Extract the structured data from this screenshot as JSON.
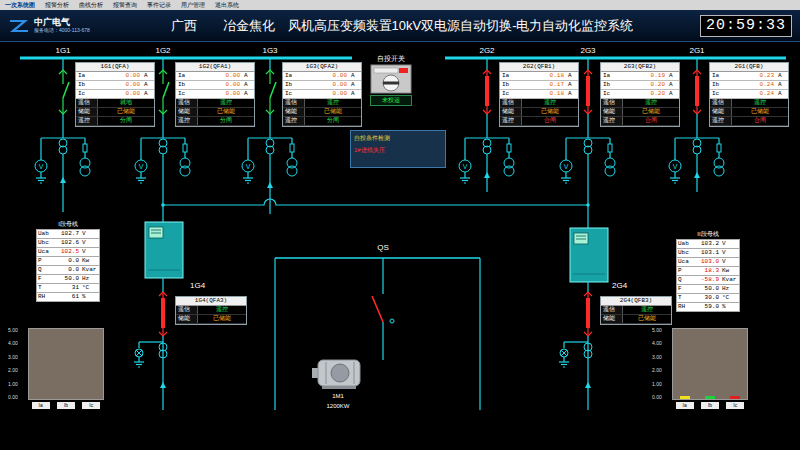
{
  "menu": [
    {
      "label": "一次系统图",
      "selected": true
    },
    {
      "label": "报警分析",
      "selected": false
    },
    {
      "label": "曲线分析",
      "selected": false
    },
    {
      "label": "报警查询",
      "selected": false
    },
    {
      "label": "事件记录",
      "selected": false
    },
    {
      "label": "用户管理",
      "selected": false
    },
    {
      "label": "退出系统",
      "selected": false
    }
  ],
  "header": {
    "logo": "中广电气",
    "phone": "服务电话：4000-113-678",
    "title": "广西　　冶金焦化　风机高压变频装置10kV双电源自动切换-电力自动化监控系统",
    "clock": "20:59:33"
  },
  "meter_glyph": "V",
  "feeders": [
    {
      "label": "1G1",
      "box_title": "1G1(QFA)",
      "closed": false,
      "currents": [
        {
          "name": "Ia",
          "value": "0.00",
          "unit": "A"
        },
        {
          "name": "Ib",
          "value": "0.00",
          "unit": "A"
        },
        {
          "name": "Ic",
          "value": "0.00",
          "unit": "A"
        }
      ],
      "status": [
        {
          "label": "遥信",
          "value": "就地"
        },
        {
          "label": "储能",
          "value": "已储能"
        },
        {
          "label": "遥控",
          "value": "分闸"
        }
      ]
    },
    {
      "label": "1G2",
      "box_title": "1G2(QFA1)",
      "closed": false,
      "currents": [
        {
          "name": "Ia",
          "value": "0.00",
          "unit": "A"
        },
        {
          "name": "Ib",
          "value": "0.00",
          "unit": "A"
        },
        {
          "name": "Ic",
          "value": "0.00",
          "unit": "A"
        }
      ],
      "status": [
        {
          "label": "遥信",
          "value": "遥控"
        },
        {
          "label": "储能",
          "value": "已储能"
        },
        {
          "label": "遥控",
          "value": "分闸"
        }
      ]
    },
    {
      "label": "1G3",
      "box_title": "1G3(QFA2)",
      "closed": false,
      "currents": [
        {
          "name": "Ia",
          "value": "0.00",
          "unit": "A"
        },
        {
          "name": "Ib",
          "value": "0.00",
          "unit": "A"
        },
        {
          "name": "Ic",
          "value": "0.00",
          "unit": "A"
        }
      ],
      "status": [
        {
          "label": "遥信",
          "value": "遥控"
        },
        {
          "label": "储能",
          "value": "已储能"
        },
        {
          "label": "遥控",
          "value": "分闸"
        }
      ]
    },
    {
      "label": "2G2",
      "box_title": "2G2(QFB1)",
      "closed": true,
      "currents": [
        {
          "name": "Ia",
          "value": "0.18",
          "unit": "A"
        },
        {
          "name": "Ib",
          "value": "0.17",
          "unit": "A"
        },
        {
          "name": "Ic",
          "value": "0.18",
          "unit": "A"
        }
      ],
      "status": [
        {
          "label": "遥信",
          "value": "遥控"
        },
        {
          "label": "储能",
          "value": "已储能"
        },
        {
          "label": "遥控",
          "value": "合闸"
        }
      ]
    },
    {
      "label": "2G3",
      "box_title": "2G3(QFB2)",
      "closed": true,
      "currents": [
        {
          "name": "Ia",
          "value": "0.19",
          "unit": "A"
        },
        {
          "name": "Ib",
          "value": "0.20",
          "unit": "A"
        },
        {
          "name": "Ic",
          "value": "0.20",
          "unit": "A"
        }
      ],
      "status": [
        {
          "label": "遥信",
          "value": "遥控"
        },
        {
          "label": "储能",
          "value": "已储能"
        },
        {
          "label": "遥控",
          "value": "合闸"
        }
      ]
    },
    {
      "label": "2G1",
      "box_title": "2G1(QFB)",
      "closed": true,
      "currents": [
        {
          "name": "Ia",
          "value": "0.23",
          "unit": "A"
        },
        {
          "name": "Ib",
          "value": "0.24",
          "unit": "A"
        },
        {
          "name": "Ic",
          "value": "0.24",
          "unit": "A"
        }
      ],
      "status": [
        {
          "label": "遥信",
          "value": "遥控"
        },
        {
          "label": "储能",
          "value": "已储能"
        },
        {
          "label": "遥控",
          "value": "合闸"
        }
      ]
    }
  ],
  "outgoing": [
    {
      "label": "1G4",
      "box_title": "1G4(QFA3)",
      "closed": true,
      "status": [
        {
          "label": "遥信",
          "value": "遥控"
        },
        {
          "label": "储能",
          "value": "已储能"
        }
      ]
    },
    {
      "label": "2G4",
      "box_title": "2G4(QFB3)",
      "closed": true,
      "status": [
        {
          "label": "遥信",
          "value": "遥控"
        },
        {
          "label": "储能",
          "value": "已储能"
        }
      ]
    }
  ],
  "bus_meters": [
    {
      "title": "I段母线",
      "rows": [
        {
          "name": "Uab",
          "value": "102.7",
          "unit": "V",
          "alarm": false
        },
        {
          "name": "Ubc",
          "value": "102.6",
          "unit": "V",
          "alarm": false
        },
        {
          "name": "Uca",
          "value": "102.5",
          "unit": "V",
          "alarm": true
        },
        {
          "name": "P",
          "value": "0.0",
          "unit": "Kw",
          "alarm": false
        },
        {
          "name": "Q",
          "value": "0.0",
          "unit": "Kvar",
          "alarm": false
        },
        {
          "name": "F",
          "value": "50.0",
          "unit": "Hz",
          "alarm": false
        },
        {
          "name": "T",
          "value": "31",
          "unit": "°C",
          "alarm": false
        },
        {
          "name": "RH",
          "value": "61",
          "unit": "%",
          "alarm": false
        }
      ]
    },
    {
      "title": "II段母线",
      "rows": [
        {
          "name": "Uab",
          "value": "103.2",
          "unit": "V",
          "alarm": false
        },
        {
          "name": "Ubc",
          "value": "103.1",
          "unit": "V",
          "alarm": false
        },
        {
          "name": "Uca",
          "value": "103.0",
          "unit": "V",
          "alarm": true
        },
        {
          "name": "P",
          "value": "18.3",
          "unit": "Kw",
          "alarm": true
        },
        {
          "name": "Q",
          "value": "-58.9",
          "unit": "Kvar",
          "alarm": true
        },
        {
          "name": "F",
          "value": "50.0",
          "unit": "Hz",
          "alarm": false
        },
        {
          "name": "T",
          "value": "30.0",
          "unit": "°C",
          "alarm": false
        },
        {
          "name": "RH",
          "value": "59.0",
          "unit": "%",
          "alarm": false
        }
      ]
    }
  ],
  "auto_switch": {
    "label": "自投开关",
    "on": false,
    "state": "未投运"
  },
  "check_panel": {
    "title": "自投条件检测",
    "message": "1#进线失压"
  },
  "qs": {
    "label": "QS",
    "closed": false
  },
  "motor": {
    "name": "1M1",
    "power": "1200KW"
  },
  "charts": [
    {
      "ticks": [
        "5.00",
        "4.00",
        "3.00",
        "2.00",
        "1.00",
        "0.00"
      ],
      "categories": [
        "Ia",
        "Ib",
        "Ic"
      ],
      "values": [
        0,
        0,
        0
      ],
      "colors": [
        "#f0e020",
        "#20d040",
        "#e02020"
      ]
    },
    {
      "ticks": [
        "5.00",
        "4.00",
        "3.00",
        "2.00",
        "1.00",
        "0.00"
      ],
      "categories": [
        "Ia",
        "Ib",
        "Ic"
      ],
      "values": [
        0.19,
        0.2,
        0.2
      ],
      "colors": [
        "#f0e020",
        "#20d040",
        "#e02020"
      ]
    }
  ]
}
